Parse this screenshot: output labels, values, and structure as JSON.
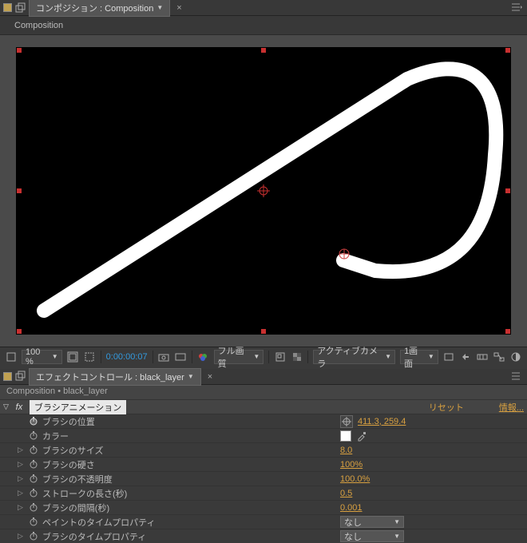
{
  "compPanel": {
    "tabLabel": "コンポジション : Composition",
    "compName": "Composition"
  },
  "previewBar": {
    "zoom": "100 %",
    "timecode": "0:00:00:07",
    "resolution": "フル画質",
    "camera": "アクティブカメラ",
    "views": "1画面"
  },
  "ecPanel": {
    "tabLabel": "エフェクトコントロール : black_layer",
    "breadcrumb": "Composition • black_layer"
  },
  "effect": {
    "name": "ブラシアニメーション",
    "reset": "リセット",
    "info": "情報...",
    "props": [
      {
        "name": "ブラシの位置",
        "value": "411.3, 259.4",
        "stopwatch": true,
        "keyed": true,
        "type": "point"
      },
      {
        "name": "カラー",
        "value": "",
        "stopwatch": true,
        "type": "color"
      },
      {
        "name": "ブラシのサイズ",
        "value": "8.0",
        "stopwatch": true,
        "type": "hot",
        "twirl": true
      },
      {
        "name": "ブラシの硬さ",
        "value": "100%",
        "stopwatch": true,
        "type": "hot",
        "twirl": true
      },
      {
        "name": "ブラシの不透明度",
        "value": "100.0%",
        "stopwatch": true,
        "type": "hot",
        "twirl": true
      },
      {
        "name": "ストロークの長さ(秒)",
        "value": "0.5",
        "stopwatch": true,
        "type": "hot",
        "twirl": true
      },
      {
        "name": "ブラシの間隔(秒)",
        "value": "0.001",
        "stopwatch": true,
        "type": "hot",
        "twirl": true
      },
      {
        "name": "ペイントのタイムプロパティ",
        "value": "なし",
        "stopwatch": true,
        "type": "dropdown"
      },
      {
        "name": "ブラシのタイムプロパティ",
        "value": "なし",
        "stopwatch": true,
        "type": "dropdown",
        "twirl": true
      }
    ]
  }
}
